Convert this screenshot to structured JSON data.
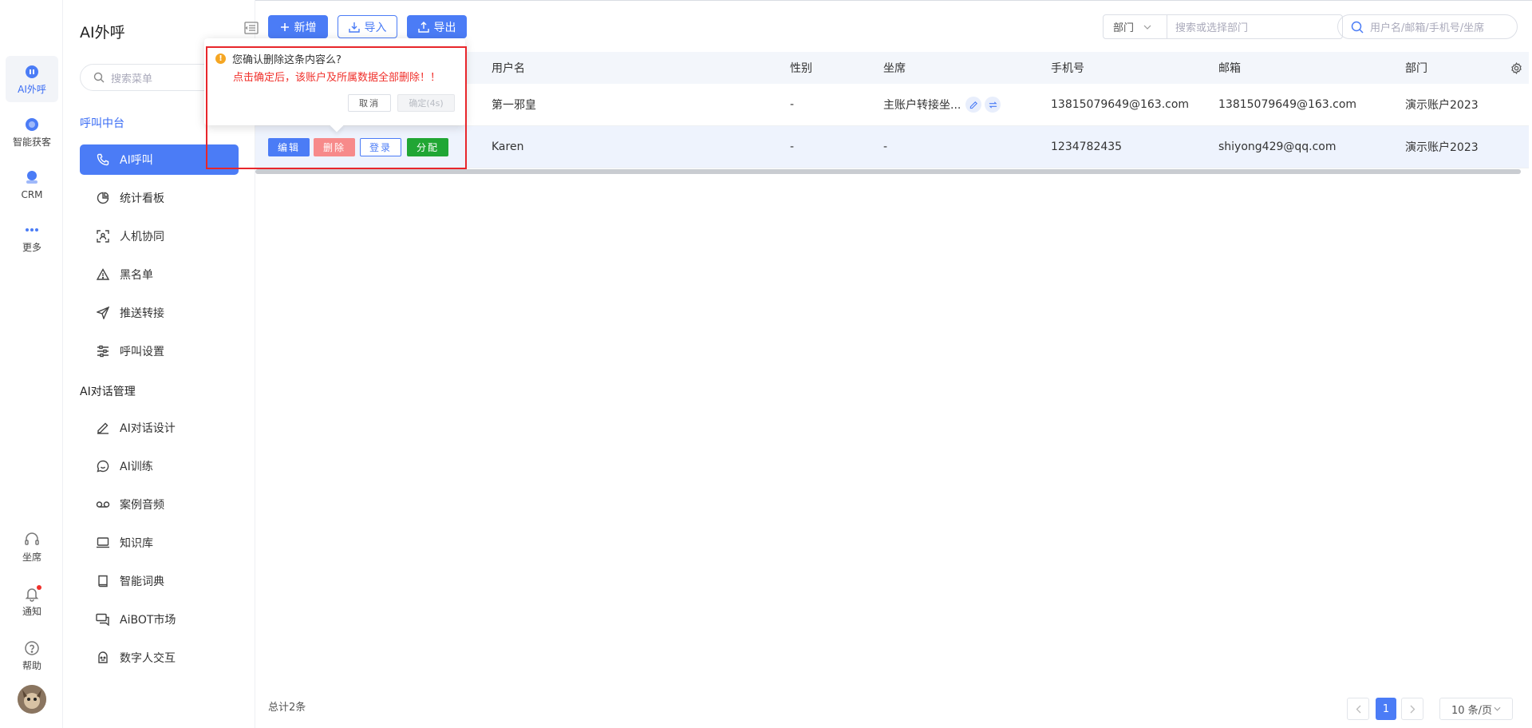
{
  "rail": {
    "items": [
      {
        "label": "AI外呼"
      },
      {
        "label": "智能获客"
      },
      {
        "label": "CRM"
      },
      {
        "label": "更多"
      }
    ],
    "bottom": [
      {
        "label": "坐席"
      },
      {
        "label": "通知"
      },
      {
        "label": "帮助"
      }
    ]
  },
  "menu": {
    "title": "AI外呼",
    "search_placeholder": "搜索菜单",
    "groups": [
      {
        "label": "呼叫中台",
        "items": [
          {
            "label": "AI呼叫",
            "icon": "phone-icon",
            "active": true
          },
          {
            "label": "统计看板",
            "icon": "pie-chart-icon"
          },
          {
            "label": "人机协同",
            "icon": "scan-user-icon"
          },
          {
            "label": "黑名单",
            "icon": "warning-icon"
          },
          {
            "label": "推送转接",
            "icon": "send-icon"
          },
          {
            "label": "呼叫设置",
            "icon": "sliders-icon"
          }
        ]
      },
      {
        "label": "AI对话管理",
        "items": [
          {
            "label": "AI对话设计",
            "icon": "pen-icon"
          },
          {
            "label": "AI训练",
            "icon": "chat-bubble-icon"
          },
          {
            "label": "案例音频",
            "icon": "voicemail-icon"
          },
          {
            "label": "知识库",
            "icon": "laptop-icon"
          },
          {
            "label": "智能词典",
            "icon": "book-icon"
          },
          {
            "label": "AiBOT市场",
            "icon": "messages-icon"
          },
          {
            "label": "数字人交互",
            "icon": "robot-icon"
          }
        ]
      }
    ]
  },
  "toolbar": {
    "add_label": "新增",
    "import_label": "导入",
    "export_label": "导出",
    "dept_select": "部门",
    "dept_placeholder": "搜索或选择部门",
    "user_search_placeholder": "用户名/邮箱/手机号/坐席"
  },
  "table": {
    "columns": [
      "用户名",
      "性别",
      "坐席",
      "手机号",
      "邮箱",
      "部门"
    ],
    "rows": [
      {
        "username": "第一邪皇",
        "gender": "-",
        "seat": "主账户转接坐...",
        "phone": "13815079649@163.com",
        "email": "13815079649@163.com",
        "dept": "演示账户2023"
      },
      {
        "username": "Karen",
        "gender": "-",
        "seat": "-",
        "phone": "1234782435",
        "email": "shiyong429@qq.com",
        "dept": "演示账户2023"
      }
    ],
    "actions": {
      "edit": "编辑",
      "delete": "删除",
      "login": "登录",
      "assign": "分配"
    }
  },
  "popconfirm": {
    "title": "您确认删除这条内容么?",
    "message": "点击确定后，该账户及所属数据全部删除！！",
    "cancel": "取消",
    "confirm": "确定(4s)"
  },
  "footer": {
    "total": "总计2条",
    "current_page": "1",
    "page_size": "10 条/页"
  },
  "colors": {
    "primary": "#4b7cf6",
    "danger": "#f0302b",
    "success": "#21a634",
    "warning": "#f5a623"
  }
}
